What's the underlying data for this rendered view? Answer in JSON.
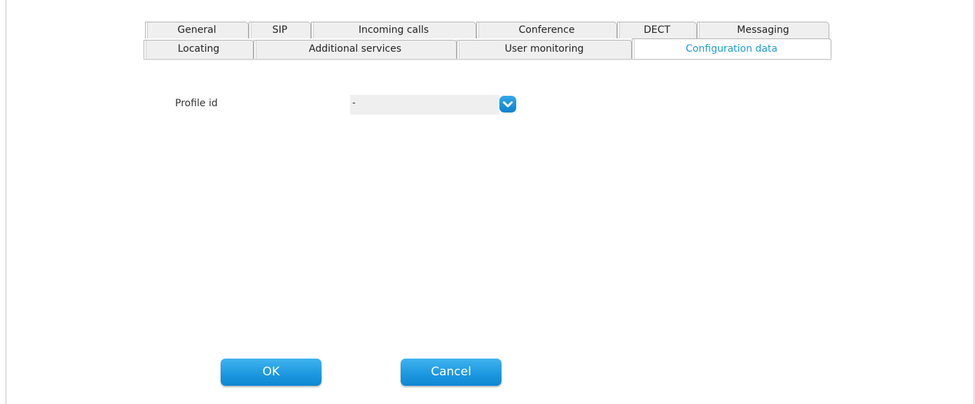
{
  "tabs": {
    "row1": [
      "General",
      "SIP",
      "Incoming calls",
      "Conference",
      "DECT",
      "Messaging"
    ],
    "row2": [
      "Locating",
      "Additional services",
      "User monitoring",
      "Configuration data"
    ],
    "active": "Configuration data"
  },
  "form": {
    "profile_label": "Profile id",
    "profile_value": "-"
  },
  "buttons": {
    "ok": "OK",
    "cancel": "Cancel"
  },
  "colors": {
    "accent": "#1d9bd6",
    "button": "#1b96df"
  }
}
